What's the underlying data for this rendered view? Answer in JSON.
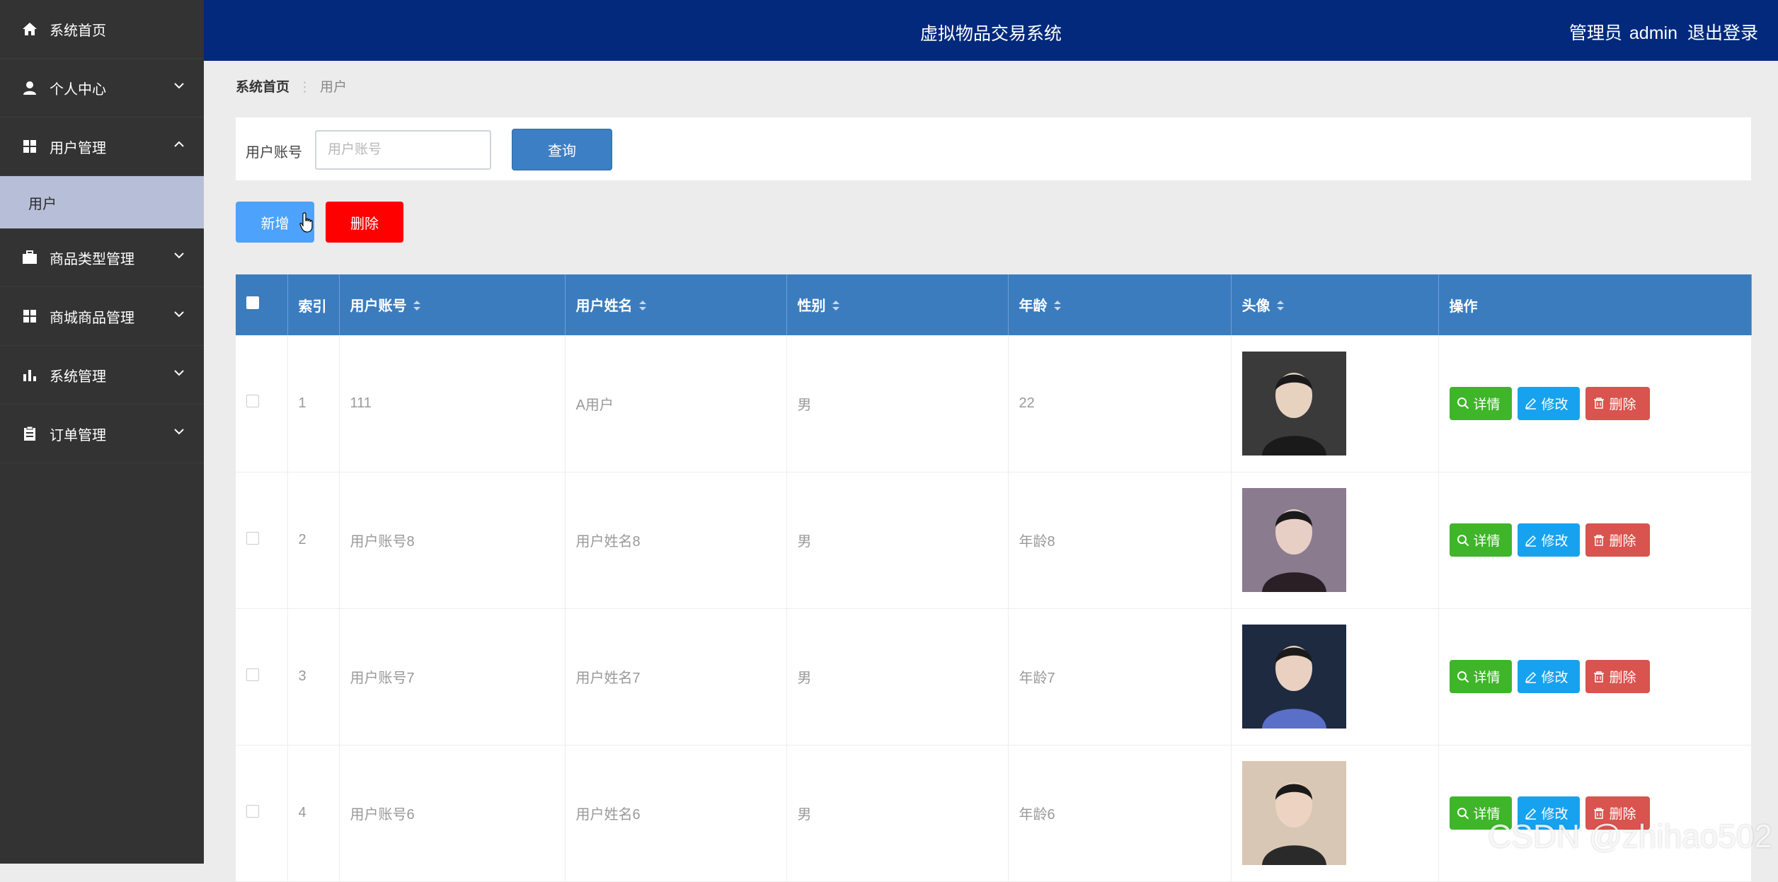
{
  "header": {
    "title": "虚拟物品交易系统",
    "role": "管理员",
    "username": "admin",
    "logout": "退出登录"
  },
  "sidebar": {
    "items": [
      {
        "label": "系统首页",
        "icon": "home-icon",
        "expandable": false
      },
      {
        "label": "个人中心",
        "icon": "user-icon",
        "expandable": true,
        "expanded": false
      },
      {
        "label": "用户管理",
        "icon": "grid-icon",
        "expandable": true,
        "expanded": true
      },
      {
        "label": "商品类型管理",
        "icon": "briefcase-icon",
        "expandable": true,
        "expanded": false
      },
      {
        "label": "商城商品管理",
        "icon": "grid-icon",
        "expandable": true,
        "expanded": false
      },
      {
        "label": "系统管理",
        "icon": "bar-chart-icon",
        "expandable": true,
        "expanded": false
      },
      {
        "label": "订单管理",
        "icon": "clipboard-icon",
        "expandable": true,
        "expanded": false
      }
    ],
    "submenu": {
      "label": "用户"
    }
  },
  "breadcrumb": {
    "home": "系统首页",
    "sep": "⋮",
    "current": "用户"
  },
  "search": {
    "label": "用户账号",
    "placeholder": "用户账号",
    "button": "查询"
  },
  "actions": {
    "add": "新增",
    "delete": "删除"
  },
  "table": {
    "headers": {
      "index": "索引",
      "account": "用户账号",
      "name": "用户姓名",
      "gender": "性别",
      "age": "年龄",
      "avatar": "头像",
      "ops": "操作"
    },
    "rows": [
      {
        "index": "1",
        "account": "111",
        "name": "A用户",
        "gender": "男",
        "age": "22",
        "avatar_colors": [
          "#3a3a3a",
          "#1a1a1a",
          "#e7d2c0"
        ]
      },
      {
        "index": "2",
        "account": "用户账号8",
        "name": "用户姓名8",
        "gender": "男",
        "age": "年龄8",
        "avatar_colors": [
          "#8a7b8f",
          "#2a1f25",
          "#e8cfc6"
        ]
      },
      {
        "index": "3",
        "account": "用户账号7",
        "name": "用户姓名7",
        "gender": "男",
        "age": "年龄7",
        "avatar_colors": [
          "#1e2a40",
          "#5a6fc8",
          "#e9d0c0"
        ]
      },
      {
        "index": "4",
        "account": "用户账号6",
        "name": "用户姓名6",
        "gender": "男",
        "age": "年龄6",
        "avatar_colors": [
          "#d9c7b5",
          "#2a2a2a",
          "#edd3c1"
        ]
      }
    ],
    "op_labels": {
      "detail": "详情",
      "edit": "修改",
      "remove": "删除"
    }
  },
  "watermark": "CSDN @zhihao502",
  "colors": {
    "topbar": "#02297c",
    "sidebar": "#333333",
    "table_header": "#3b7cbf",
    "detail": "#3fb52a",
    "edit": "#17a2ef",
    "remove": "#d9534f",
    "delete_btn": "#ff0000",
    "add_btn": "#4da2fb"
  }
}
